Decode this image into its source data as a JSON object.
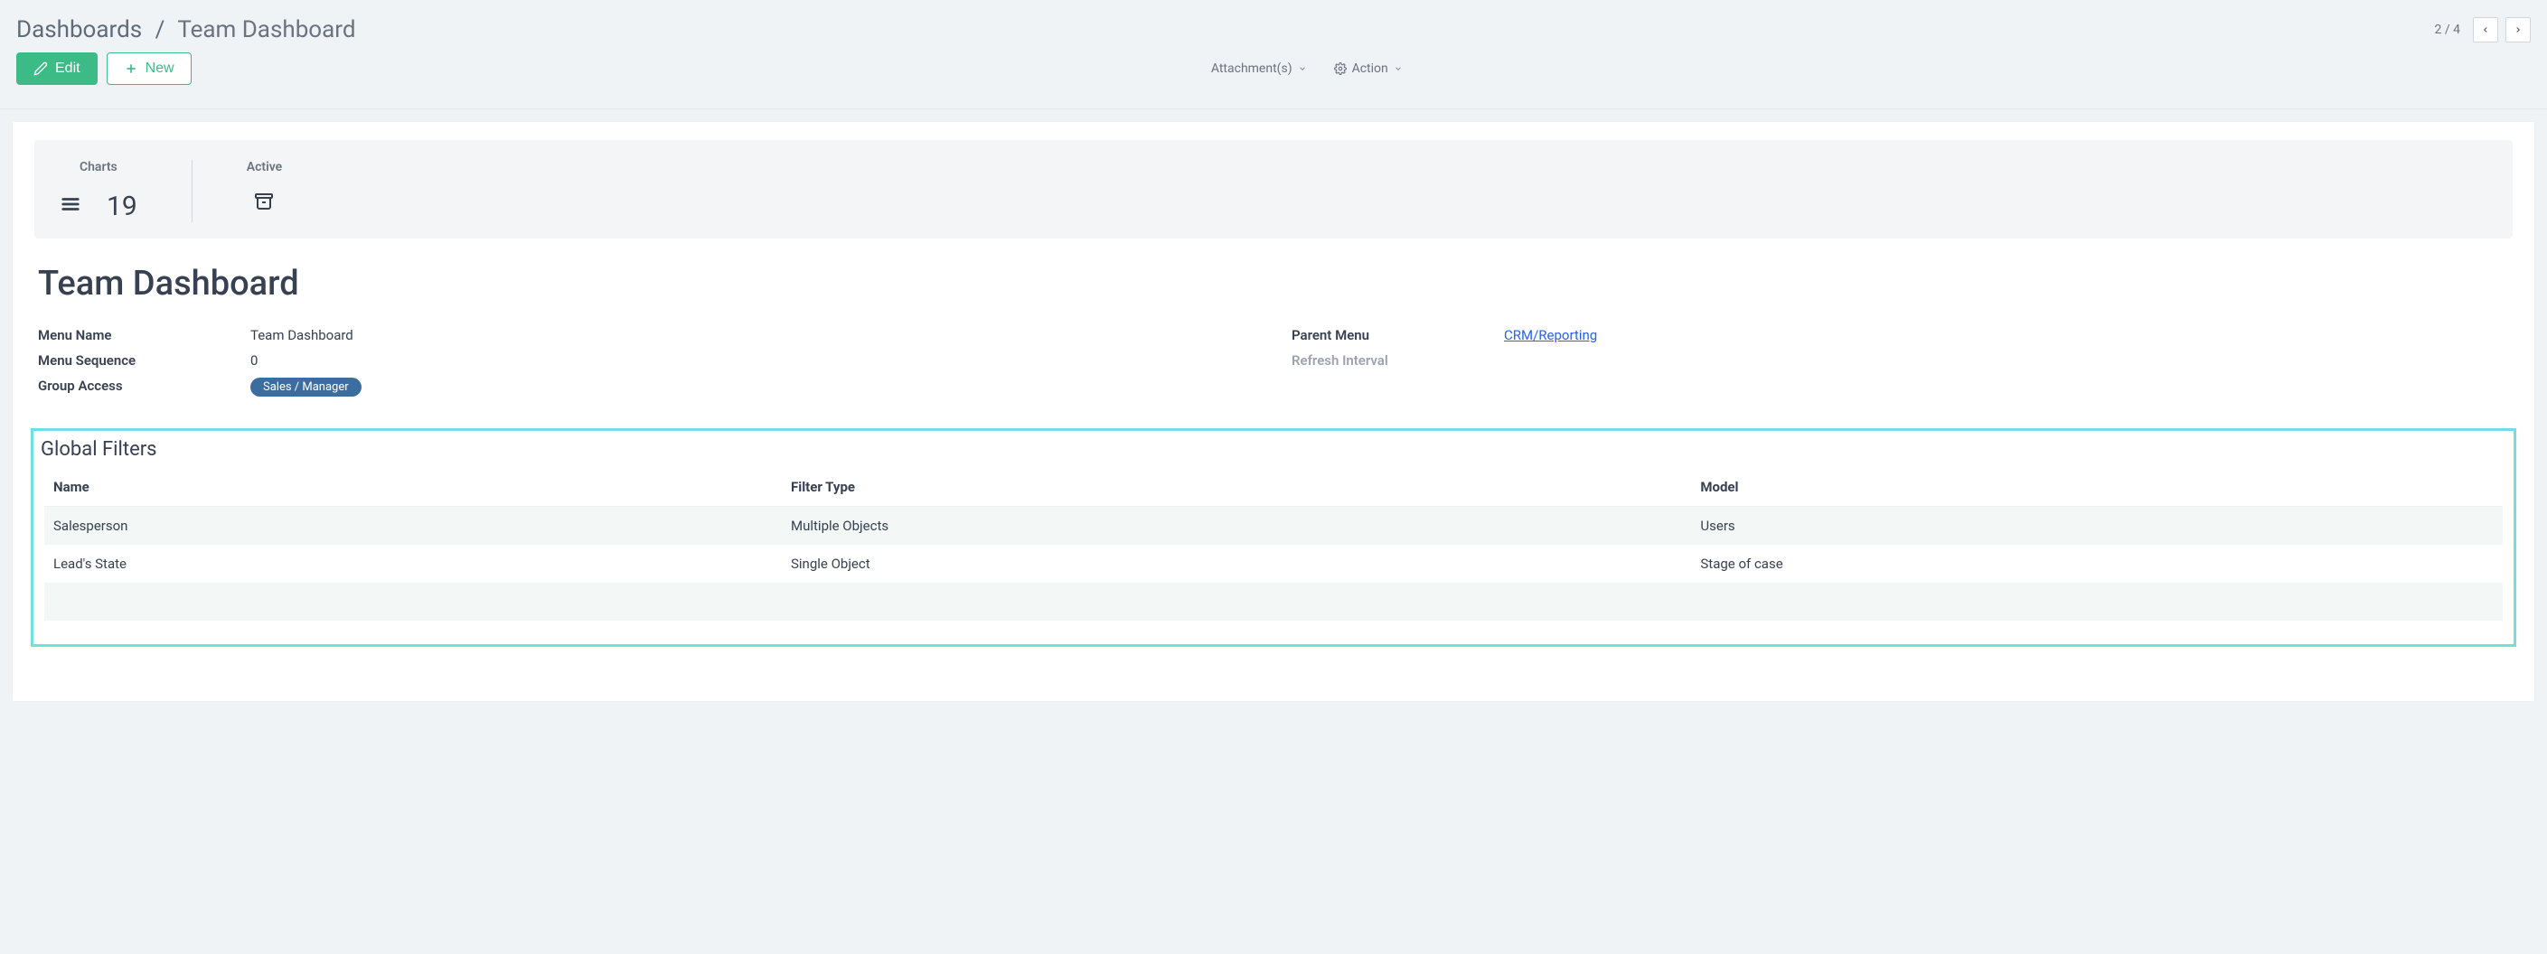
{
  "breadcrumb": {
    "root": "Dashboards",
    "current": "Team Dashboard"
  },
  "pager": {
    "index": "2",
    "total": "4"
  },
  "buttons": {
    "edit": "Edit",
    "new": "New"
  },
  "center": {
    "attachments": "Attachment(s)",
    "action": "Action"
  },
  "stats": {
    "charts_label": "Charts",
    "charts_count": "19",
    "active_label": "Active"
  },
  "title": "Team Dashboard",
  "fields": {
    "menu_name_label": "Menu Name",
    "menu_name_value": "Team Dashboard",
    "menu_sequence_label": "Menu Sequence",
    "menu_sequence_value": "0",
    "group_access_label": "Group Access",
    "group_access_tag": "Sales / Manager",
    "parent_menu_label": "Parent Menu",
    "parent_menu_value": "CRM/Reporting",
    "refresh_interval_label": "Refresh Interval",
    "refresh_interval_value": ""
  },
  "global_filters": {
    "title": "Global Filters",
    "headers": {
      "name": "Name",
      "filter_type": "Filter Type",
      "model": "Model"
    },
    "rows": [
      {
        "name": "Salesperson",
        "filter_type": "Multiple Objects",
        "model": "Users"
      },
      {
        "name": "Lead's State",
        "filter_type": "Single Object",
        "model": "Stage of case"
      }
    ]
  }
}
